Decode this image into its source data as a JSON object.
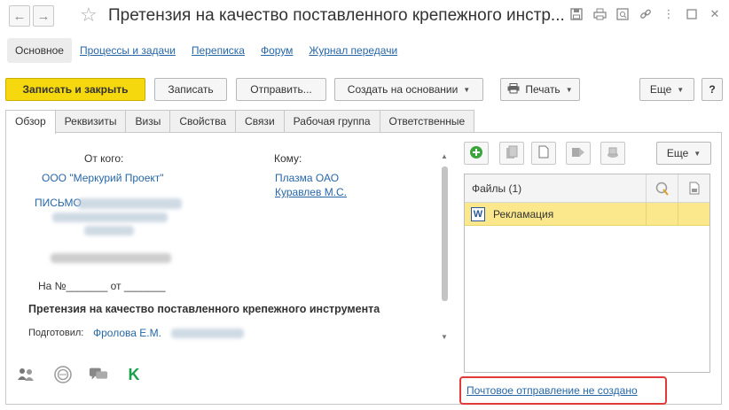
{
  "window": {
    "title": "Претензия на качество поставленного крепежного инстр..."
  },
  "sections": [
    {
      "label": "Основное"
    },
    {
      "label": "Процессы и задачи"
    },
    {
      "label": "Переписка"
    },
    {
      "label": "Форум"
    },
    {
      "label": "Журнал передачи"
    }
  ],
  "toolbar": {
    "save_close": "Записать и закрыть",
    "save": "Записать",
    "send": "Отправить...",
    "create_based": "Создать на основании",
    "print": "Печать",
    "more": "Еще",
    "help": "?"
  },
  "tabs": [
    {
      "label": "Обзор"
    },
    {
      "label": "Реквизиты"
    },
    {
      "label": "Визы"
    },
    {
      "label": "Свойства"
    },
    {
      "label": "Связи"
    },
    {
      "label": "Рабочая группа"
    },
    {
      "label": "Ответственные"
    }
  ],
  "letter": {
    "from_label": "От кого:",
    "from_org": "ООО \"Меркурий Проект\"",
    "letter_prefix": "ПИСЬМО",
    "to_label": "Кому:",
    "to_org": "Плазма ОАО",
    "to_person": "Куравлев М.С.",
    "number_line": "На №_______ от _______",
    "subject": "Претензия на качество поставленного крепежного инструмента",
    "prepared_label": "Подготовил:",
    "prepared_by": "Фролова Е.М."
  },
  "files": {
    "more": "Еще",
    "header": "Файлы (1)",
    "rows": [
      {
        "name": "Рекламация"
      }
    ],
    "mail_status": "Почтовое отправление не создано"
  },
  "colors": {
    "primary_button": "#f5d80d",
    "link": "#2767a8",
    "selected_row": "#fbe88d",
    "highlight_border": "#e03a3a"
  }
}
